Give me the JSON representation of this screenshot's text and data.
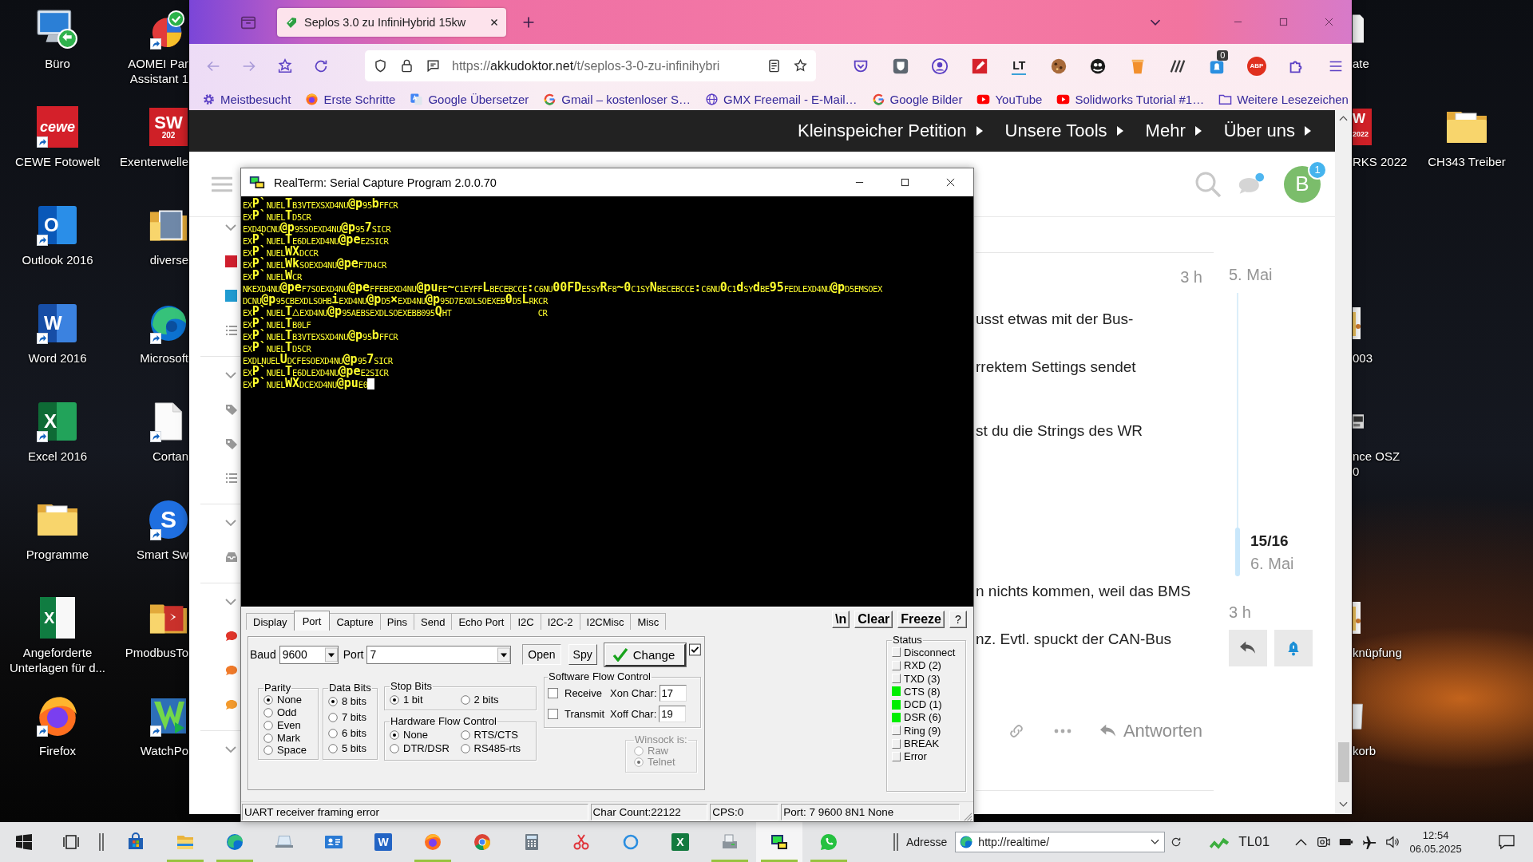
{
  "desktop": {
    "column_1": [
      {
        "lines": [
          "Büro"
        ],
        "kind": "remote",
        "shortcut": false
      },
      {
        "lines": [
          "CEWE Fotowelt"
        ],
        "kind": "cewe",
        "glyph": "cewe",
        "shortcut": true
      },
      {
        "lines": [
          "Outlook 2016"
        ],
        "kind": "outlook",
        "glyph": "O",
        "shortcut": true
      },
      {
        "lines": [
          "Word 2016"
        ],
        "kind": "word",
        "glyph": "W",
        "shortcut": true
      },
      {
        "lines": [
          "Excel 2016"
        ],
        "kind": "excel",
        "glyph": "X",
        "shortcut": true
      },
      {
        "lines": [
          "Programme"
        ],
        "kind": "folder",
        "shortcut": false
      },
      {
        "lines": [
          "Angeforderte",
          "Unterlagen für d..."
        ],
        "kind": "sheet",
        "glyph": "X",
        "shortcut": false
      },
      {
        "lines": [
          "Firefox"
        ],
        "kind": "firefox",
        "shortcut": true
      }
    ],
    "column_2": [
      {
        "lines": [
          "AOMEI Par",
          "Assistant 1"
        ],
        "kind": "aomei",
        "shortcut": true
      },
      {
        "lines": [
          "Exenterwelle"
        ],
        "kind": "solidworks",
        "glyph": "SW",
        "glyph_sub": "202",
        "shortcut": false
      },
      {
        "lines": [
          "diverse"
        ],
        "kind": "photo-folder",
        "shortcut": false
      },
      {
        "lines": [
          "Microsoft"
        ],
        "kind": "edge",
        "shortcut": true
      },
      {
        "lines": [
          "Cortan"
        ],
        "kind": "blank",
        "shortcut": true
      },
      {
        "lines": [
          "Smart Sw"
        ],
        "kind": "smartswitch",
        "glyph": "S",
        "shortcut": true
      },
      {
        "lines": [
          "PmodbusTo"
        ],
        "kind": "pdf-folder",
        "shortcut": false
      },
      {
        "lines": [
          "WatchPo"
        ],
        "kind": "watchport",
        "shortcut": true
      }
    ],
    "column_3": [
      {
        "lines": [
          "ate"
        ],
        "kind": "blank"
      },
      {
        "lines": [
          "RKS 2022"
        ],
        "kind": "solidworks",
        "glyph": "W",
        "glyph_sub": "2022"
      },
      {
        "lines": [
          "003"
        ],
        "kind": "folder"
      },
      {
        "lines": [
          "nce OSZ",
          "0"
        ],
        "kind": "scope"
      },
      {
        "lines": [
          "knüpfung"
        ],
        "kind": "folder"
      },
      {
        "lines": [
          "korb"
        ],
        "kind": "bin"
      }
    ],
    "column_4": [
      {
        "lines": [
          "CH343 Treiber"
        ],
        "kind": "driver-folder",
        "shortcut": false
      }
    ]
  },
  "browser": {
    "tab_title": "Seplos 3.0 zu InfiniHybrid 15kw",
    "url_scheme": "https://",
    "url_host": "akkudoktor.net",
    "url_path": "/t/seplos-3-0-zu-infinihybri",
    "extensions": [
      {
        "kind": "pocket"
      },
      {
        "kind": "vault"
      },
      {
        "kind": "account"
      },
      {
        "kind": "pen"
      },
      {
        "kind": "lt",
        "glyph": "LT"
      },
      {
        "kind": "cookie"
      },
      {
        "kind": "ghost"
      },
      {
        "kind": "bucket"
      },
      {
        "kind": "slashes"
      },
      {
        "kind": "counter",
        "badge": "0"
      },
      {
        "kind": "abp",
        "glyph": "ABP"
      },
      {
        "kind": "puzzle"
      }
    ],
    "bookmarks": [
      {
        "label": "Meistbesucht",
        "kind": "gear"
      },
      {
        "label": "Erste Schritte",
        "kind": "firefox"
      },
      {
        "label": "Google Übersetzer",
        "kind": "translate"
      },
      {
        "label": "Gmail – kostenloser S…",
        "kind": "google"
      },
      {
        "label": "GMX Freemail - E-Mail…",
        "kind": "globe"
      },
      {
        "label": "Google Bilder",
        "kind": "google"
      },
      {
        "label": "YouTube",
        "kind": "youtube"
      },
      {
        "label": "Solidworks Tutorial #1…",
        "kind": "youtube"
      },
      {
        "label": "Weitere Lesezeichen",
        "kind": "folder"
      }
    ]
  },
  "site": {
    "nav": [
      "Kleinspeicher Petition",
      "Unsere Tools",
      "Mehr",
      "Über uns"
    ],
    "avatar": "B",
    "avatar_badge": "1",
    "sidebar": [
      {
        "expanded": true,
        "items": [
          {
            "kind": "category",
            "color": "#cf1f2e"
          },
          {
            "kind": "category",
            "color": "#1f9bd1"
          },
          {
            "kind": "list"
          }
        ]
      },
      {
        "expanded": true,
        "items": [
          {
            "kind": "tag"
          },
          {
            "kind": "tag"
          },
          {
            "kind": "list"
          }
        ]
      },
      {
        "expanded": true,
        "items": [
          {
            "kind": "inbox"
          }
        ]
      },
      {
        "expanded": true,
        "items": [
          {
            "kind": "chat",
            "color": "#e0342a"
          },
          {
            "kind": "chat",
            "color": "#f07a2a"
          },
          {
            "kind": "chat",
            "color": "#f39a2c"
          }
        ]
      },
      {
        "expanded": true
      }
    ],
    "post": {
      "time": "3 h",
      "lines": [
        "usst etwas mit der Bus-",
        "rrektem Settings sendet",
        "st du die Strings des WR",
        "n nichts kommen, weil das BMS",
        "nz. Evtl. spuckt der CAN-Bus"
      ],
      "reply": "Antworten"
    },
    "timeline": {
      "start": "5. Mai",
      "position": "15/16",
      "date": "6. Mai",
      "end": "3 h"
    }
  },
  "realterm": {
    "title": "RealTerm: Serial Capture Program 2.0.0.70",
    "terminal_lines": [
      "$_{EX}$P`$_{NU}$$_{EL}$T$_{B3}$$_{VT}$$_{EX}$$_{SX}$$_{D4}$$_{NU}$@p$_{95}$b$_{FF}$$_{CR}$",
      "$_{EX}$P`$_{NU}$$_{EL}$T$_{D5}$$_{CR}$",
      "$_{EX}$$_{D4}$$_{DC}$$_{NU}$@p$_{95}$$_{SO}$$_{EX}$$_{D4}$$_{NU}$@p$_{95}$7$_{SI}$$_{CR}$",
      "$_{EX}$P`$_{NU}$$_{EL}$T$_{E6}$$_{DL}$$_{EX}$$_{D4}$$_{NU}$@pe$_{E2}$$_{SI}$$_{CR}$",
      "$_{EX}$P`$_{NU}$$_{EL}$WX$_{DC}$$_{CR}$",
      "$_{EX}$P`$_{NU}$$_{EL}$Wk$_{SO}$$_{EX}$$_{D4}$$_{NU}$@pe$_{F7}$$_{D4}$$_{CR}$",
      "$_{EX}$P`$_{NU}$$_{EL}$W$_{CR}$",
      "$_{NK}$$_{EX}$$_{D4}$$_{NU}$@pe$_{F7}$$_{SO}$$_{EX}$$_{D4}$$_{NU}$@pe$_{FF}$$_{EB}$$_{EX}$$_{D4}$$_{NU}$@pu$_{FE}$~$_{C1}$$_{EY}$$_{FF}$L$_{BE}$$_{CE}$$_{BC}$$_{CE}$:$_{C6}$$_{NU}$00FD$_{E5}$$_{SY}$R$_{F8}$~0$_{C1}$$_{SY}$N$_{BE}$$_{CE}$$_{BC}$$_{CE}$:$_{C6}$$_{NU}$0$_{C1}$d$_{SY}$d$_{BE}$95$_{FE}$$_{DL}$$_{EX}$$_{D4}$$_{NU}$@p$_{D5}$$_{EM}$$_{SO}$$_{EX}$",
      "$_{DC}$$_{NU}$@p$_{95}$$_{CB}$$_{EX}$$_{DL}$$_{SO}$$_{HB}$i$_{EX}$$_{D4}$$_{NU}$@p$_{D5}$×$_{EX}$$_{D4}$$_{NU}$@p$_{95}$$_{D7}$$_{EX}$$_{DL}$$_{SO}$$_{EX}$$_{EB}$0$_{D5}$L$_{RK}$$_{CR}$",
      "$_{EX}$P`$_{NU}$$_{EL}$T△$_{EX}$$_{D4}$$_{NU}$@p$_{95}$$_{AE}$$_{BS}$$_{EX}$$_{DL}$$_{SO}$$_{EX}$$_{EB}$$_{B0}$$_{95}$Q$_{HT}$            $_{CR}$",
      "$_{EX}$P`$_{NU}$$_{EL}$T$_{B0}$$_{LF}$",
      "$_{EX}$P`$_{NU}$$_{EL}$T$_{B3}$$_{VT}$$_{EX}$$_{SX}$$_{D4}$$_{NU}$@p$_{95}$b$_{FF}$$_{CR}$",
      "$_{EX}$P`$_{NU}$$_{EL}$T$_{D5}$$_{CR}$",
      "$_{EX}$$_{DL}$$_{NU}$$_{EL}$U$_{DC}$$_{FE}$$_{SO}$$_{EX}$$_{D4}$$_{NU}$@p$_{95}$7$_{SI}$$_{CR}$",
      "$_{EX}$P`$_{NU}$$_{EL}$T$_{E6}$$_{DL}$$_{EX}$$_{D4}$$_{NU}$@pe$_{E2}$$_{SI}$$_{CR}$",
      "$_{EX}$P`$_{NU}$$_{EL}$WX$_{DC}$$_{EX}$$_{D4}$$_{NU}$@pu$_{E0}$"
    ],
    "tabs": [
      {
        "label": "Display",
        "selected": false
      },
      {
        "label": "Port",
        "selected": true
      },
      {
        "label": "Capture",
        "selected": false
      },
      {
        "label": "Pins",
        "selected": false
      },
      {
        "label": "Send",
        "selected": false
      },
      {
        "label": "Echo Port",
        "selected": false
      },
      {
        "label": "I2C",
        "selected": false
      },
      {
        "label": "I2C-2",
        "selected": false
      },
      {
        "label": "I2CMisc",
        "selected": false
      },
      {
        "label": "Misc",
        "selected": false
      }
    ],
    "tool_buttons": [
      "\\n",
      "Clear",
      "Freeze",
      "?"
    ],
    "baud": {
      "label": "Baud",
      "value": "9600"
    },
    "port": {
      "label": "Port",
      "value": "7"
    },
    "buttons": [
      "Open",
      "Spy"
    ],
    "change": "Change",
    "change_checked": true,
    "parity": {
      "title": "Parity",
      "options": [
        {
          "label": "None",
          "selected": true
        },
        {
          "label": "Odd",
          "selected": false
        },
        {
          "label": "Even",
          "selected": false
        },
        {
          "label": "Mark",
          "selected": false
        },
        {
          "label": "Space",
          "selected": false
        }
      ]
    },
    "data_bits": {
      "title": "Data Bits",
      "options": [
        {
          "label": "8 bits",
          "selected": true
        },
        {
          "label": "7 bits",
          "selected": false
        },
        {
          "label": "6 bits",
          "selected": false
        },
        {
          "label": "5 bits",
          "selected": false
        }
      ]
    },
    "stop_bits": {
      "title": "Stop Bits",
      "options": [
        {
          "label": "1 bit",
          "selected": true
        },
        {
          "label": "2 bits",
          "selected": false
        }
      ]
    },
    "hardware_flow": {
      "title": "Hardware Flow Control",
      "options": [
        {
          "label": "None",
          "selected": true
        },
        {
          "label": "RTS/CTS",
          "selected": false
        },
        {
          "label": "DTR/DSR",
          "selected": false
        },
        {
          "label": "RS485-rts",
          "selected": false
        }
      ]
    },
    "software_flow": {
      "title": "Software Flow Control",
      "rows": [
        {
          "label": "Receive",
          "checked": false,
          "char_label": "Xon Char:",
          "char_value": "17"
        },
        {
          "label": "Transmit",
          "checked": false,
          "char_label": "Xoff Char:",
          "char_value": "19"
        }
      ]
    },
    "winsock": {
      "title": "Winsock is:",
      "disabled": true,
      "options": [
        {
          "label": "Raw",
          "selected": false
        },
        {
          "label": "Telnet",
          "selected": true
        }
      ]
    },
    "status": {
      "title": "Status",
      "items": [
        {
          "label": "Disconnect",
          "on": false
        },
        {
          "label": "RXD (2)",
          "on": false
        },
        {
          "label": "TXD (3)",
          "on": false
        },
        {
          "label": "CTS (8)",
          "on": true
        },
        {
          "label": "DCD (1)",
          "on": true
        },
        {
          "label": "DSR (6)",
          "on": true
        },
        {
          "label": "Ring (9)",
          "on": false
        },
        {
          "label": "BREAK",
          "on": false
        },
        {
          "label": "Error",
          "on": false
        }
      ]
    },
    "status_bar": [
      "UART receiver framing error",
      "Char Count:22122",
      "CPS:0",
      "Port: 7 9600 8N1 None"
    ]
  },
  "taskbar": {
    "apps": [
      {
        "kind": "store",
        "running": false,
        "selected": false
      },
      {
        "kind": "explorer",
        "running": true,
        "selected": false
      },
      {
        "kind": "edge",
        "running": true,
        "selected": false
      },
      {
        "kind": "laptop",
        "running": false,
        "selected": false
      },
      {
        "kind": "contacts",
        "running": false,
        "selected": false
      },
      {
        "kind": "word",
        "glyph": "W",
        "running": false,
        "selected": false
      },
      {
        "kind": "firefox",
        "running": true,
        "selected": false
      },
      {
        "kind": "chrome",
        "running": false,
        "selected": false
      },
      {
        "kind": "calculator",
        "running": false,
        "selected": false
      },
      {
        "kind": "scissors",
        "running": false,
        "selected": false
      },
      {
        "kind": "ring",
        "running": false,
        "selected": false
      },
      {
        "kind": "excel",
        "glyph": "X",
        "running": false,
        "selected": false
      },
      {
        "kind": "scanner",
        "running": true,
        "selected": false
      },
      {
        "kind": "terminal",
        "running": true,
        "selected": true
      },
      {
        "kind": "whatsapp",
        "running": true,
        "selected": false
      }
    ],
    "address_label": "Adresse",
    "address": "http://realtime/",
    "tray_label": "TL01",
    "time": "12:54",
    "date": "06.05.2025"
  }
}
